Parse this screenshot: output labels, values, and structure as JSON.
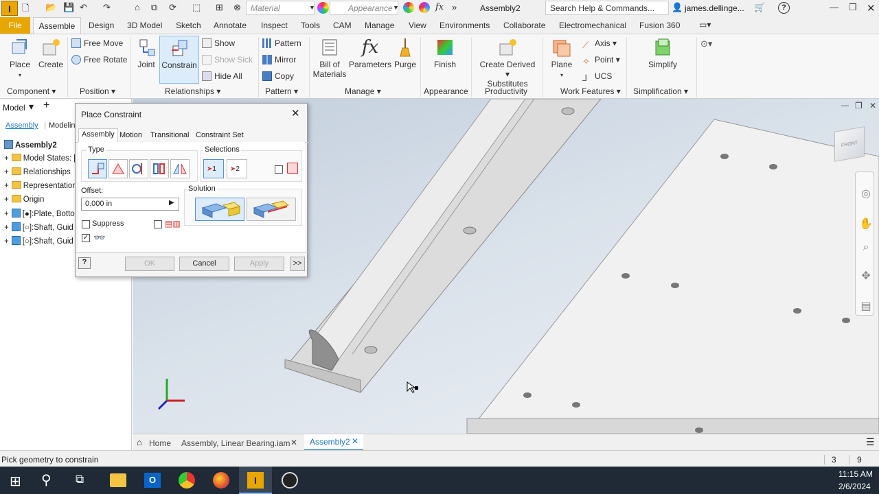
{
  "qat": {
    "material": "Material",
    "appearance": "Appearance",
    "doc_title": "Assembly2",
    "search": "Search Help & Commands...",
    "user": "james.dellinge..."
  },
  "tabs": [
    "File",
    "Assemble",
    "Design",
    "3D Model",
    "Sketch",
    "Annotate",
    "Inspect",
    "Tools",
    "CAM",
    "Manage",
    "View",
    "Environments",
    "Collaborate",
    "Electromechanical",
    "Fusion 360"
  ],
  "ribbon": {
    "place": "Place",
    "create": "Create",
    "free_move": "Free Move",
    "free_rotate": "Free Rotate",
    "joint": "Joint",
    "constrain": "Constrain",
    "show": "Show",
    "show_sick": "Show Sick",
    "hide_all": "Hide All",
    "pattern": "Pattern",
    "mirror": "Mirror",
    "copy": "Copy",
    "bill_of": "Bill of",
    "materials": "Materials",
    "parameters": "Parameters",
    "purge": "Purge",
    "finish": "Finish",
    "create_derived": "Create Derived",
    "substitutes": "Substitutes",
    "plane": "Plane",
    "axis": "Axis",
    "point": "Point",
    "ucs": "UCS",
    "simplify": "Simplify",
    "groups": {
      "component": "Component",
      "position": "Position",
      "relationships": "Relationships",
      "pattern": "Pattern",
      "manage": "Manage",
      "appearance": "Appearance",
      "productivity": "Productivity",
      "work_features": "Work Features",
      "simplification": "Simplification"
    }
  },
  "browser": {
    "title": "Model",
    "tab_assembly": "Assembly",
    "tab_modeling": "Modeling",
    "items": [
      "Assembly2",
      "Model States: [",
      "Relationships",
      "Representation",
      "Origin",
      "[●]:Plate, Botto",
      "[○]:Shaft, Guid",
      "[○]:Shaft, Guid"
    ]
  },
  "dialog": {
    "title": "Place Constraint",
    "tabs": [
      "Assembly",
      "Motion",
      "Transitional",
      "Constraint Set"
    ],
    "type_label": "Type",
    "selections_label": "Selections",
    "sel1": "1",
    "sel2": "2",
    "offset_label": "Offset:",
    "offset_value": "0.000 in",
    "solution_label": "Solution",
    "suppress": "Suppress",
    "ok": "OK",
    "cancel": "Cancel",
    "apply": "Apply",
    "more": ">>"
  },
  "doc_tabs": {
    "home": "Home",
    "tab1": "Assembly, Linear Bearing.iam",
    "tab2": "Assembly2"
  },
  "status": {
    "message": "Pick geometry to constrain",
    "num1": "3",
    "num2": "9"
  },
  "taskbar": {
    "time": "11:15 AM",
    "date": "2/6/2024"
  },
  "colors": {
    "accent_orange": "#e8a600",
    "active_tab_blue": "#1e78c8",
    "taskbar": "#1f2a36"
  }
}
